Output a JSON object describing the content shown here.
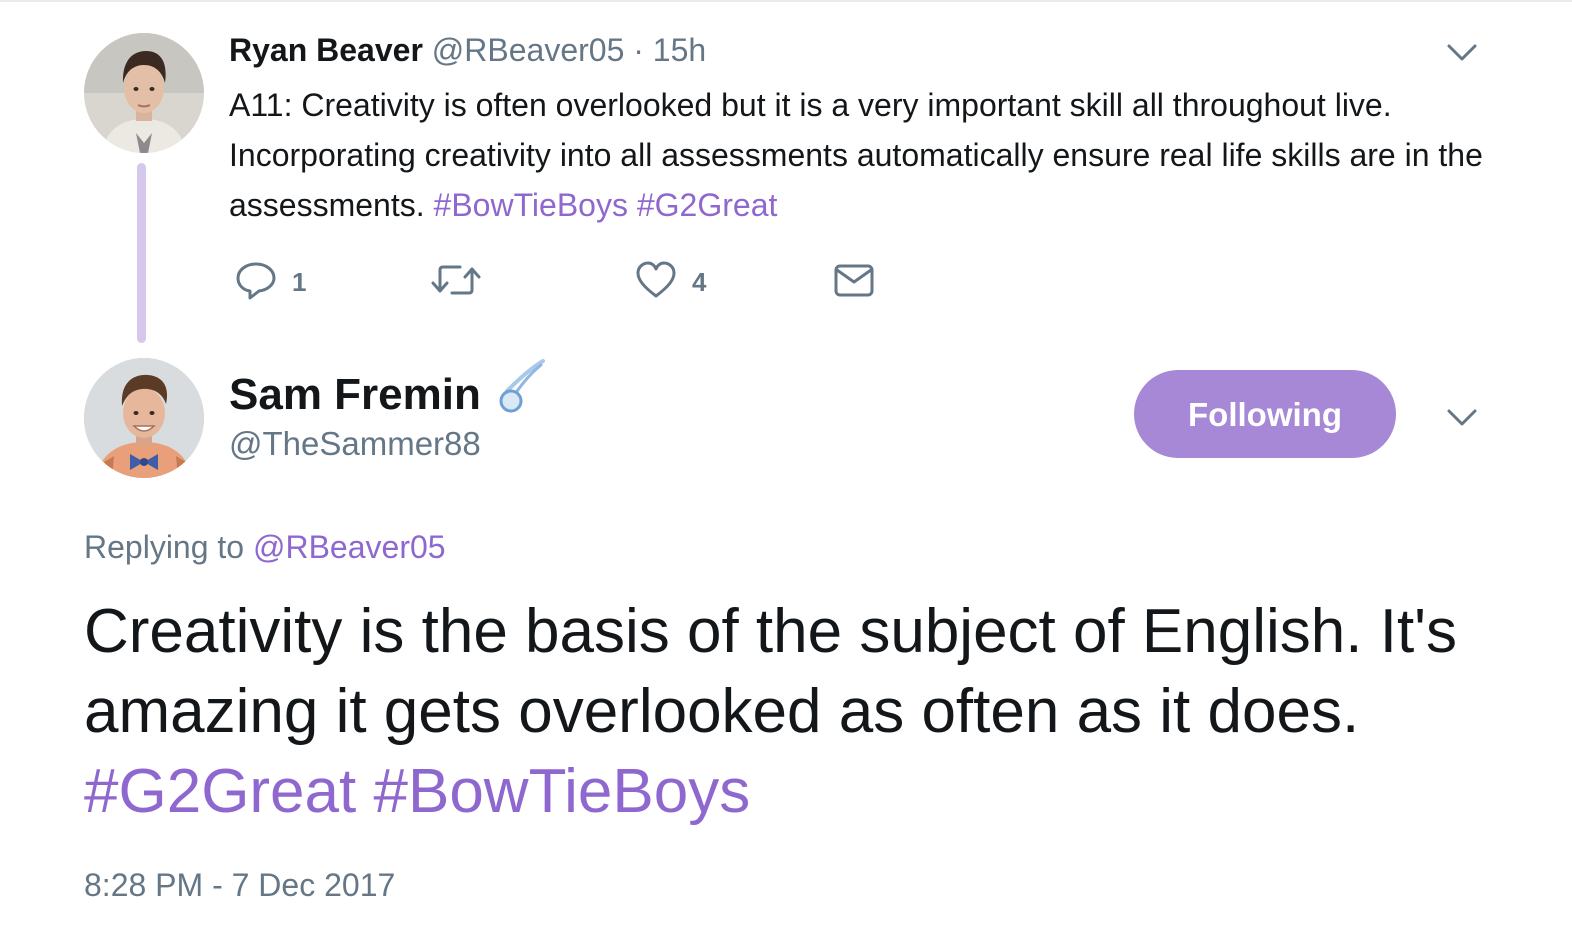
{
  "parent_tweet": {
    "author_name": "Ryan Beaver",
    "author_handle": "@RBeaver05",
    "separator": "·",
    "time_ago": "15h",
    "text": "A11: Creativity is often overlooked but it is a very important skill all throughout live. Incorporating creativity into all assessments automatically ensure real life skills are in the assessments.",
    "hashtags": [
      "#BowTieBoys",
      "#G2Great"
    ],
    "actions": {
      "reply_icon": "reply-icon",
      "reply_count": "1",
      "retweet_icon": "retweet-icon",
      "like_icon": "heart-icon",
      "like_count": "4",
      "dm_icon": "envelope-icon"
    }
  },
  "tweet": {
    "author_name": "Sam Fremin",
    "author_badge_icon": "comet-icon",
    "author_handle": "@TheSammer88",
    "follow_button_label": "Following",
    "replying_prefix": "Replying to",
    "replying_handle": "@RBeaver05",
    "text": "Creativity is the basis of the subject of English. It's amazing it gets overlooked as often as it does.",
    "hashtags": [
      "#G2Great",
      "#BowTieBoys"
    ],
    "timestamp": "8:28 PM - 7 Dec 2017"
  },
  "colors": {
    "accent": "#8f68cf",
    "follow_button": "#a688d7",
    "thread_line": "#d5c8ea",
    "muted_text": "#657786",
    "text": "#14171a"
  }
}
